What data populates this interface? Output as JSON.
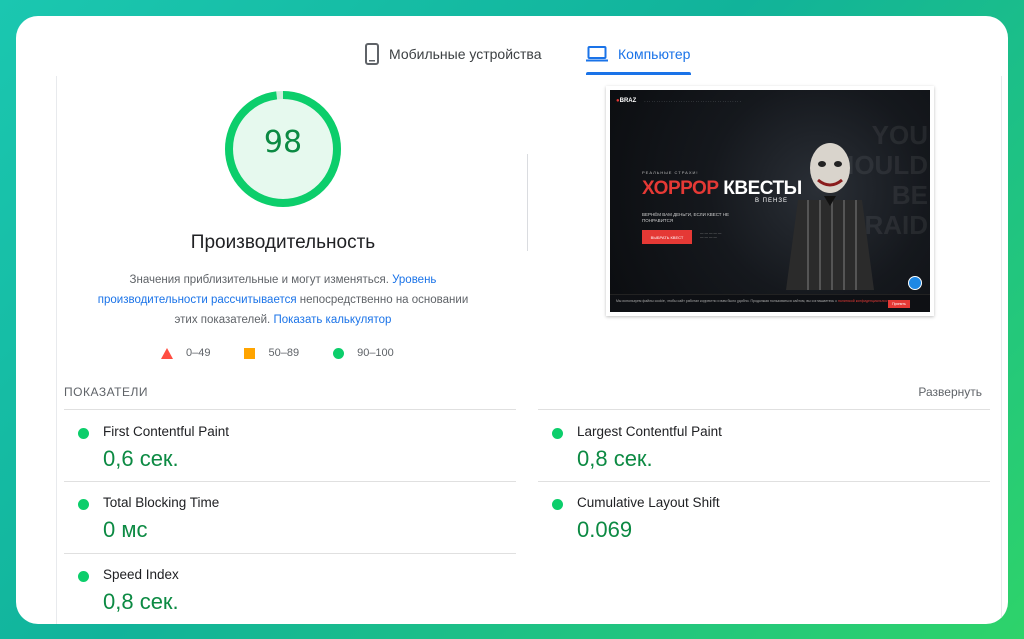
{
  "tabs": {
    "mobile_label": "Мобильные устройства",
    "desktop_label": "Компьютер"
  },
  "score": {
    "value": "98",
    "fraction": 0.98,
    "title": "Производительность"
  },
  "description": {
    "part1": "Значения приблизительные и могут изменяться.",
    "link1": "Уровень производительности рассчитывается",
    "part2": "непосредственно на основании этих показателей.",
    "link2": "Показать калькулятор"
  },
  "legend": {
    "poor": "0–49",
    "average": "50–89",
    "good": "90–100"
  },
  "colors": {
    "good": "#0cce6b",
    "average": "#ffa400",
    "poor": "#ff4e42",
    "accent": "#1a73e8"
  },
  "screenshot": {
    "logo": "BRAZ",
    "tagline": "РЕАЛЬНЫЕ СТРАХИ!",
    "headline_red": "ХОРРОР",
    "headline_white": "КВЕСТЫ",
    "headline_sub": "В ПЕНЗЕ",
    "subtext": "ВЕРНЁМ ВАМ ДЕНЬГИ, ЕСЛИ КВЕСТ НЕ ПОНРАВИТСЯ",
    "button": "ВЫБРАТЬ КВЕСТ",
    "cookie_text": "Мы используем файлы cookie, чтобы сайт работал корректно и вам было удобно. Продолжая пользоваться сайтом, вы соглашаетесь с",
    "cookie_link": "политикой конфиденциальности",
    "cookie_button": "Принять"
  },
  "metrics": {
    "title": "ПОКАЗАТЕЛИ",
    "expand_label": "Развернуть",
    "items": [
      {
        "name": "First Contentful Paint",
        "value": "0,6 сек."
      },
      {
        "name": "Largest Contentful Paint",
        "value": "0,8 сек."
      },
      {
        "name": "Total Blocking Time",
        "value": "0 мс"
      },
      {
        "name": "Cumulative Layout Shift",
        "value": "0.069"
      },
      {
        "name": "Speed Index",
        "value": "0,8 сек."
      }
    ]
  }
}
